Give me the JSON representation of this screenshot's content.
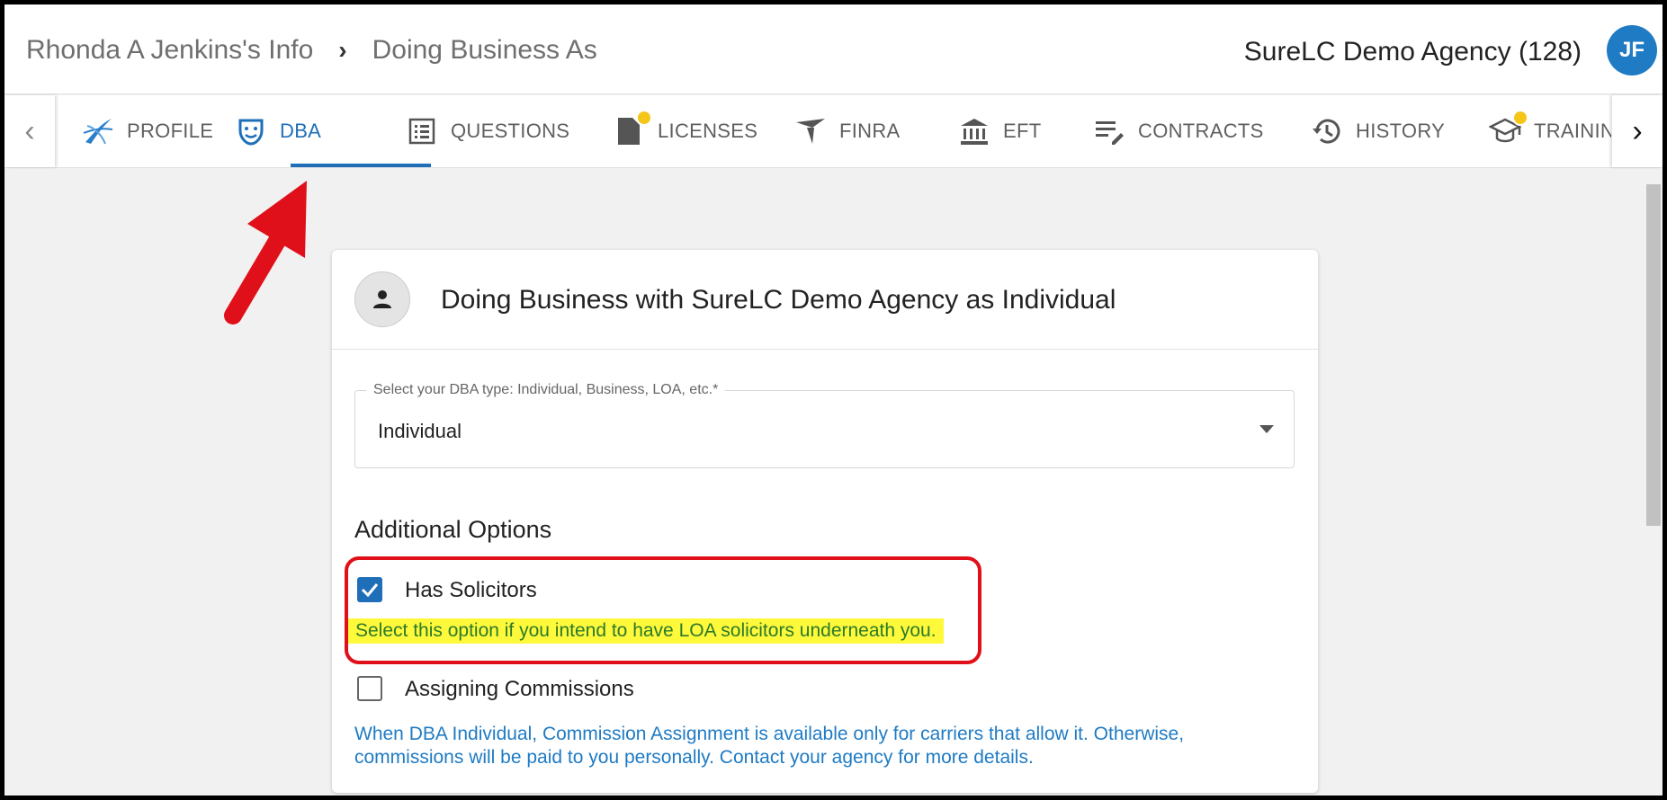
{
  "header": {
    "breadcrumb": [
      "Rhonda A Jenkins's Info",
      "Doing Business As"
    ],
    "agency": "SureLC Demo Agency (128)",
    "avatar_initials": "JF"
  },
  "tabs": [
    {
      "label": "PROFILE",
      "icon": "profile-swirl-icon",
      "active": false,
      "badge": false
    },
    {
      "label": "DBA",
      "icon": "mask-icon",
      "active": true,
      "badge": false
    },
    {
      "label": "QUESTIONS",
      "icon": "list-icon",
      "active": false,
      "badge": false
    },
    {
      "label": "LICENSES",
      "icon": "document-icon",
      "active": false,
      "badge": true
    },
    {
      "label": "FINRA",
      "icon": "finra-icon",
      "active": false,
      "badge": false
    },
    {
      "label": "EFT",
      "icon": "bank-icon",
      "active": false,
      "badge": false
    },
    {
      "label": "CONTRACTS",
      "icon": "edit-list-icon",
      "active": false,
      "badge": false
    },
    {
      "label": "HISTORY",
      "icon": "history-icon",
      "active": false,
      "badge": false
    },
    {
      "label": "TRAINING",
      "icon": "graduation-cap-icon",
      "active": false,
      "badge": true
    }
  ],
  "card": {
    "title": "Doing Business with SureLC Demo Agency as Individual",
    "select_label": "Select your DBA type: Individual, Business, LOA, etc.*",
    "select_value": "Individual",
    "section_title": "Additional Options",
    "options": [
      {
        "label": "Has Solicitors",
        "checked": true,
        "hint": "Select this option if you intend to have LOA solicitors underneath you."
      },
      {
        "label": "Assigning Commissions",
        "checked": false,
        "hint": "When DBA Individual, Commission Assignment is available only for carriers that allow it. Otherwise, commissions will be paid to you personally. Contact your agency for more details."
      }
    ]
  },
  "colors": {
    "accent": "#1f6fb8",
    "highlight": "#fff93b",
    "annotation": "#e0101a",
    "badge": "#f5c518"
  }
}
